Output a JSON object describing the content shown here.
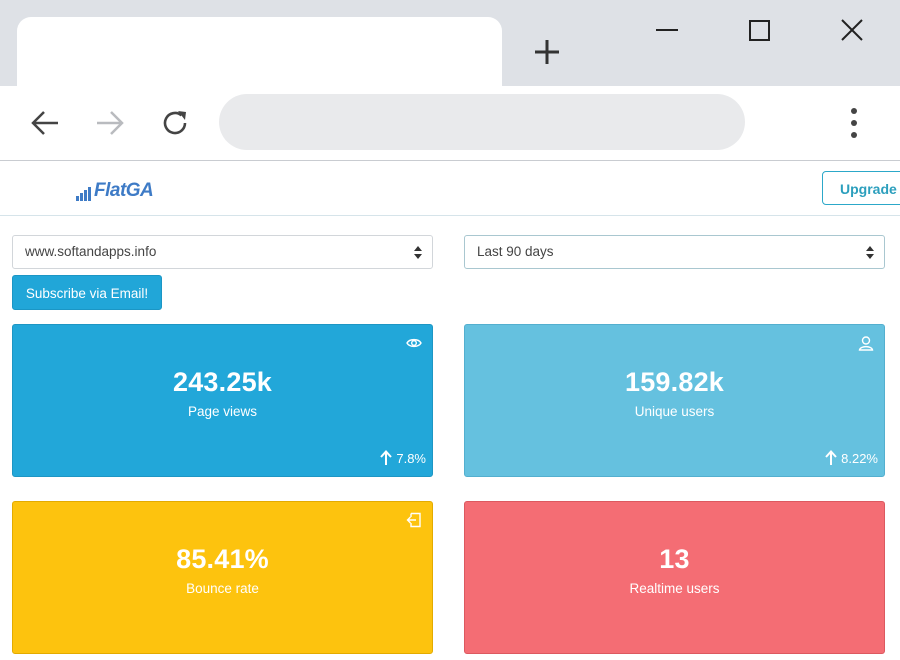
{
  "browser": {
    "icons": {
      "new_tab": "plus-icon",
      "minimize": "minimize-icon",
      "maximize": "maximize-icon",
      "close": "close-icon",
      "back": "arrow-left-icon",
      "forward": "arrow-right-icon",
      "reload": "reload-icon",
      "menu": "kebab-menu-icon"
    }
  },
  "app": {
    "logo_text": "FlatGA",
    "upgrade_label": "Upgrade",
    "site_select": {
      "value": "www.softandapps.info"
    },
    "range_select": {
      "value": "Last 90 days"
    },
    "subscribe_label": "Subscribe via Email!",
    "colors": {
      "brand": "#3e7bc6",
      "page_views": "#22a7d9",
      "unique_users": "#65c1df",
      "bounce_rate": "#fdc30e",
      "realtime": "#f46d74"
    }
  },
  "stats": {
    "page_views": {
      "value": "243.25k",
      "label": "Page views",
      "trend": "7.8%",
      "icon": "eye-icon"
    },
    "unique_users": {
      "value": "159.82k",
      "label": "Unique users",
      "trend": "8.22%",
      "icon": "user-icon"
    },
    "bounce_rate": {
      "value": "85.41%",
      "label": "Bounce rate",
      "icon": "exit-icon"
    },
    "realtime_users": {
      "value": "13",
      "label": "Realtime users"
    }
  }
}
